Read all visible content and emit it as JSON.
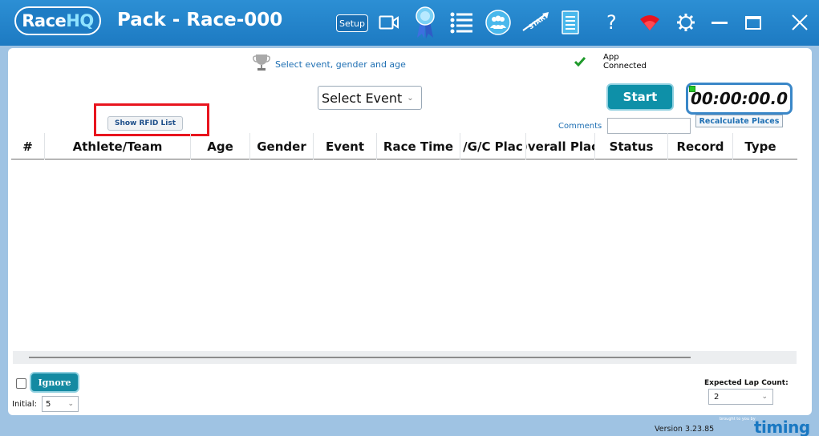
{
  "app": {
    "logo_prefix": "Race",
    "logo_suffix": "HQ",
    "title": "Pack - Race-000"
  },
  "toolbar": {
    "setup_label": "Setup",
    "icons": [
      "video-camera-icon",
      "award-ribbon-icon",
      "list-icon",
      "group-icon",
      "start-flag-icon",
      "document-icon",
      "help-icon",
      "wifi-icon",
      "settings-icon",
      "minimize-icon",
      "maximize-icon",
      "close-icon"
    ],
    "help_glyph": "?"
  },
  "main": {
    "hint": "Select event, gender and age",
    "connection_status": "App Connected",
    "event_select": "Select Event",
    "start_label": "Start",
    "timer": "00:00:00.0",
    "recalculate_label": "Recalculate Places",
    "show_rfid_label": "Show RFID List",
    "comments_label": "Comments",
    "comments_value": ""
  },
  "table": {
    "columns": [
      "#",
      "Athlete/Team",
      "Age",
      "Gender",
      "Event",
      "Race Time",
      "/G/C Plac",
      ")verall Plac",
      "Status",
      "Record",
      "Type"
    ],
    "rows": []
  },
  "footer": {
    "ignore_label": "Ignore",
    "initial_label": "Initial:",
    "initial_value": "5",
    "lap_count_label": "Expected Lap Count:",
    "lap_count_value": "2",
    "version": "Version 3.23.85",
    "brought_by": "brought to you by",
    "brand": "timing"
  },
  "colors": {
    "titlebar": "#1d7ac2",
    "background": "#9fc3e3",
    "accent_button": "#0e90a8",
    "link_blue": "#1e6fb3",
    "highlight_red": "#e8141e"
  }
}
